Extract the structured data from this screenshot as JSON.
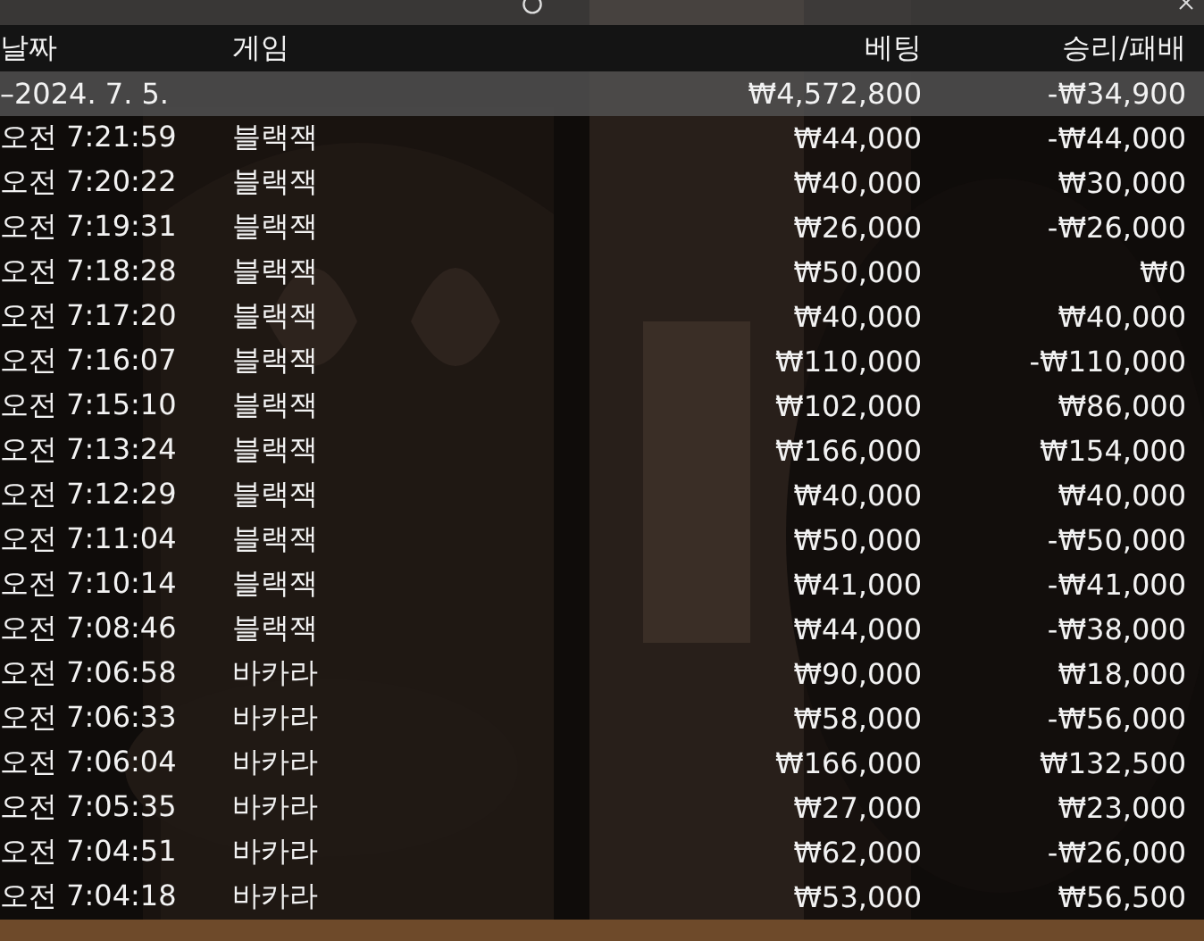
{
  "columns": [
    "날짜",
    "게임",
    "베팅",
    "승리/패배"
  ],
  "summary": {
    "date": "–2024. 7. 5.",
    "bet": "₩4,572,800",
    "result": "-₩34,900"
  },
  "rows": [
    {
      "time": "오전 7:21:59",
      "game": "블랙잭",
      "bet": "₩44,000",
      "result": "-₩44,000"
    },
    {
      "time": "오전 7:20:22",
      "game": "블랙잭",
      "bet": "₩40,000",
      "result": "₩30,000"
    },
    {
      "time": "오전 7:19:31",
      "game": "블랙잭",
      "bet": "₩26,000",
      "result": "-₩26,000"
    },
    {
      "time": "오전 7:18:28",
      "game": "블랙잭",
      "bet": "₩50,000",
      "result": "₩0"
    },
    {
      "time": "오전 7:17:20",
      "game": "블랙잭",
      "bet": "₩40,000",
      "result": "₩40,000"
    },
    {
      "time": "오전 7:16:07",
      "game": "블랙잭",
      "bet": "₩110,000",
      "result": "-₩110,000"
    },
    {
      "time": "오전 7:15:10",
      "game": "블랙잭",
      "bet": "₩102,000",
      "result": "₩86,000"
    },
    {
      "time": "오전 7:13:24",
      "game": "블랙잭",
      "bet": "₩166,000",
      "result": "₩154,000"
    },
    {
      "time": "오전 7:12:29",
      "game": "블랙잭",
      "bet": "₩40,000",
      "result": "₩40,000"
    },
    {
      "time": "오전 7:11:04",
      "game": "블랙잭",
      "bet": "₩50,000",
      "result": "-₩50,000"
    },
    {
      "time": "오전 7:10:14",
      "game": "블랙잭",
      "bet": "₩41,000",
      "result": "-₩41,000"
    },
    {
      "time": "오전 7:08:46",
      "game": "블랙잭",
      "bet": "₩44,000",
      "result": "-₩38,000"
    },
    {
      "time": "오전 7:06:58",
      "game": "바카라",
      "bet": "₩90,000",
      "result": "₩18,000"
    },
    {
      "time": "오전 7:06:33",
      "game": "바카라",
      "bet": "₩58,000",
      "result": "-₩56,000"
    },
    {
      "time": "오전 7:06:04",
      "game": "바카라",
      "bet": "₩166,000",
      "result": "₩132,500"
    },
    {
      "time": "오전 7:05:35",
      "game": "바카라",
      "bet": "₩27,000",
      "result": "₩23,000"
    },
    {
      "time": "오전 7:04:51",
      "game": "바카라",
      "bet": "₩62,000",
      "result": "-₩26,000"
    },
    {
      "time": "오전 7:04:18",
      "game": "바카라",
      "bet": "₩53,000",
      "result": "₩56,500"
    }
  ]
}
